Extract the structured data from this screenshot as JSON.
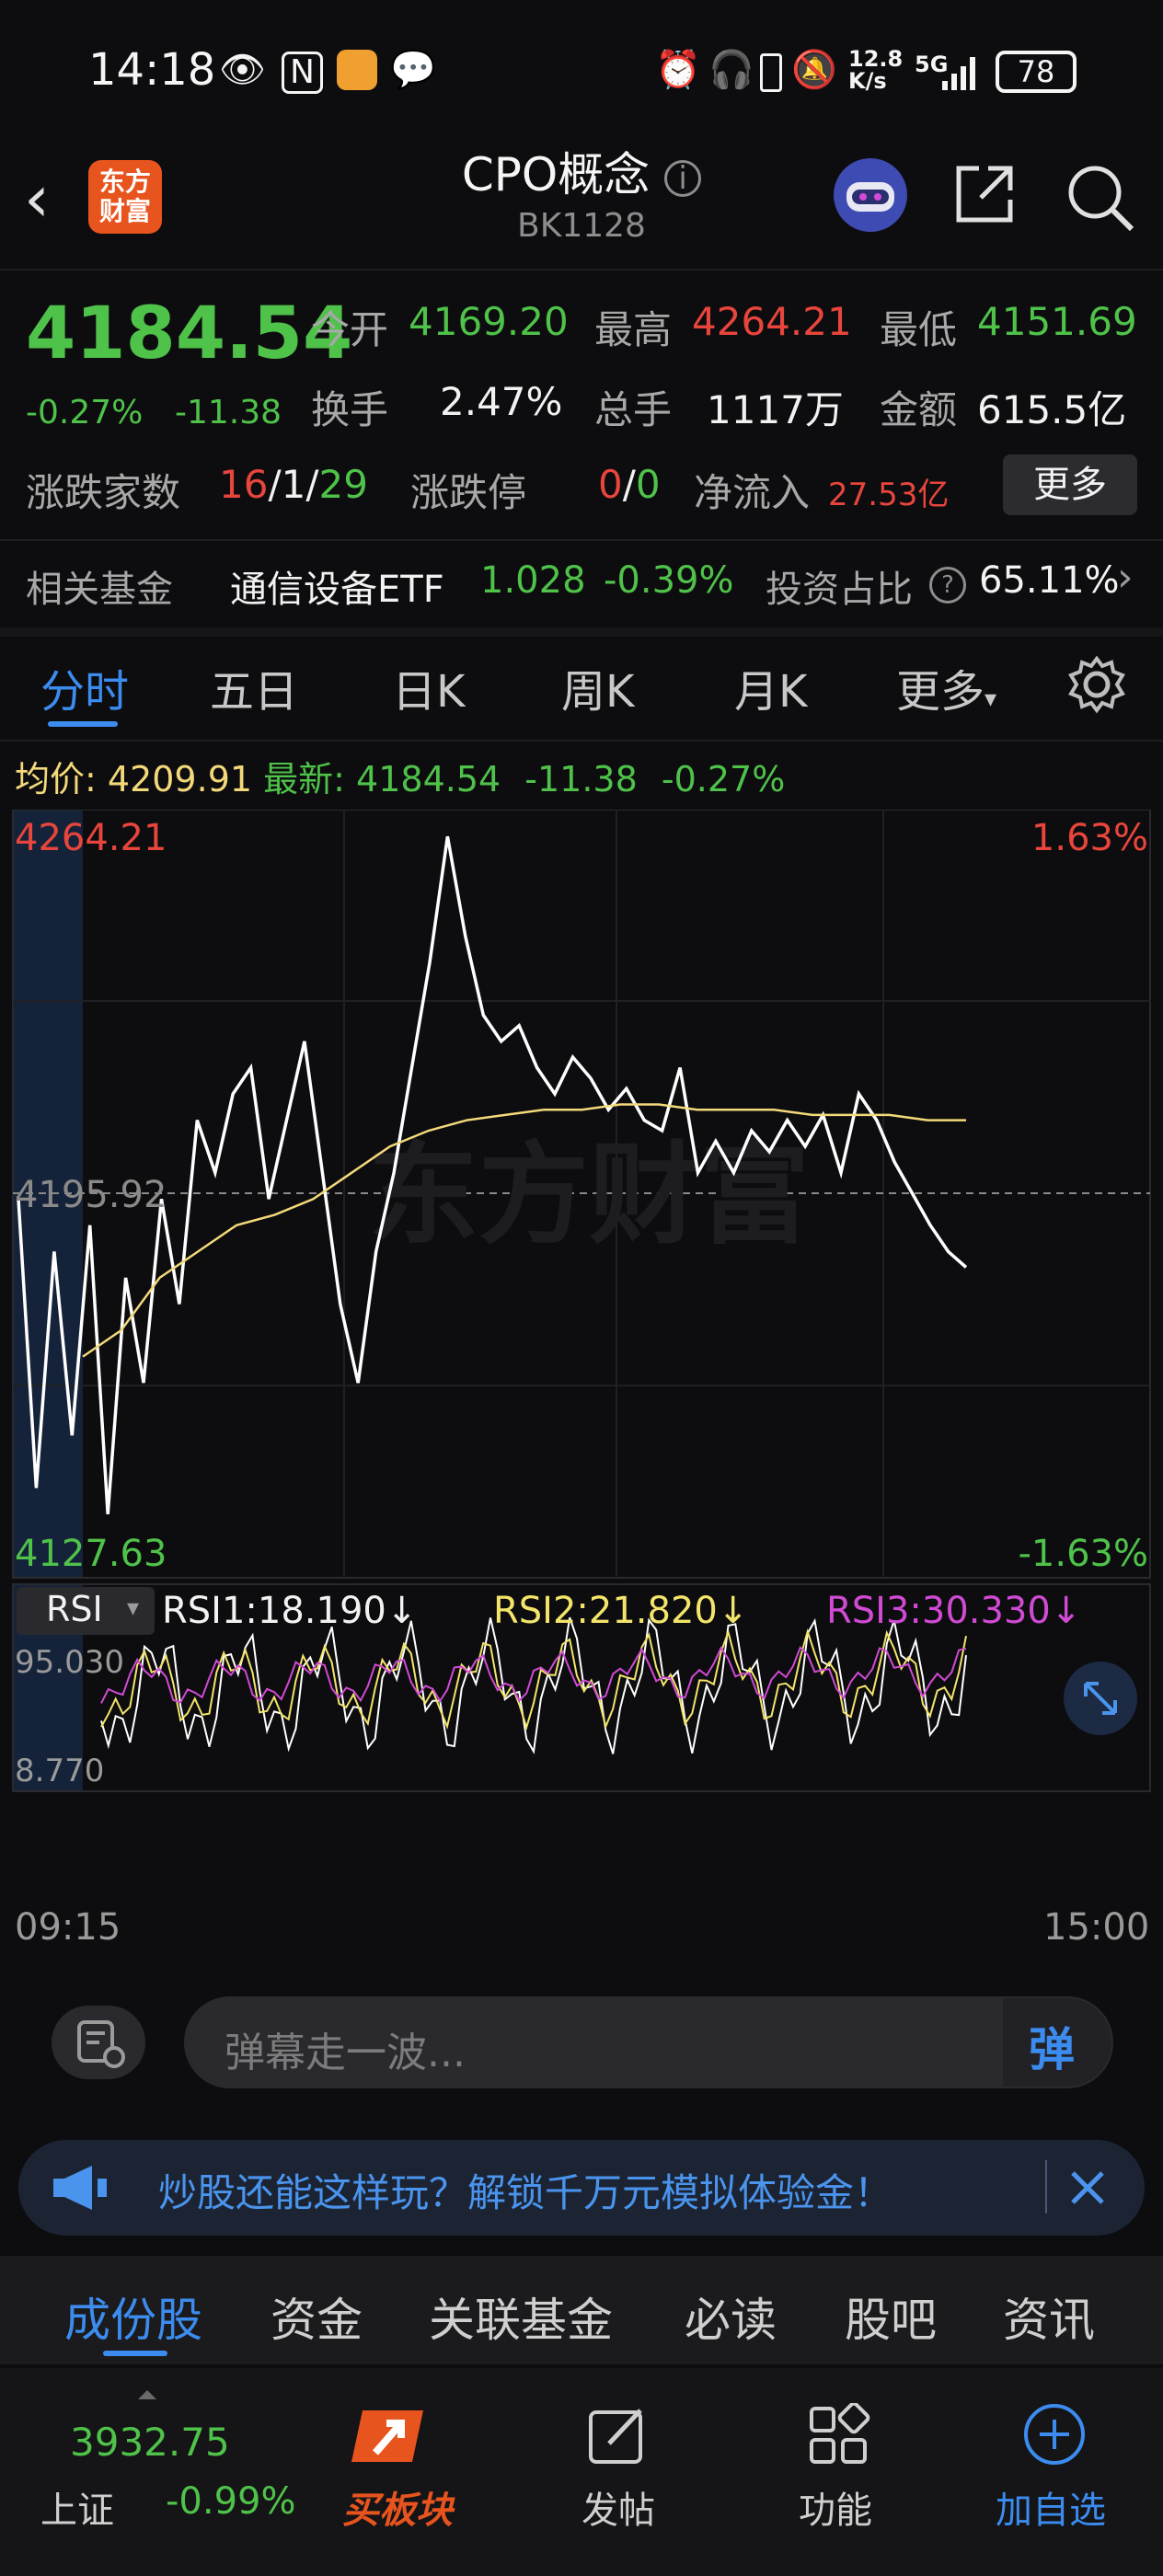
{
  "status": {
    "time": "14:18",
    "speed": "12.8\nK/s",
    "network": "5G",
    "battery": "78"
  },
  "header": {
    "logo_text": "东方\n财富",
    "title": "CPO概念",
    "code": "BK1128"
  },
  "quote": {
    "last": "4184.54",
    "pct": "-0.27%",
    "chg": "-11.38",
    "open_label": "今开",
    "open": "4169.20",
    "high_label": "最高",
    "high": "4264.21",
    "low_label": "最低",
    "low": "4151.69",
    "turnover_label": "换手",
    "turnover": "2.47%",
    "volume_label": "总手",
    "volume": "1117万",
    "amount_label": "金额",
    "amount": "615.5亿",
    "updown_label": "涨跌家数",
    "up": "16",
    "flat": "1",
    "down": "29",
    "limit_label": "涨跌停",
    "limit_up": "0",
    "limit_down": "0",
    "netflow_label": "净流入",
    "netflow": "27.53亿",
    "more": "更多"
  },
  "fund": {
    "label": "相关基金",
    "name": "通信设备ETF",
    "price": "1.028",
    "pct": "-0.39%",
    "ratio_label": "投资占比",
    "ratio": "65.11%"
  },
  "tabs": [
    "分时",
    "五日",
    "日K",
    "周K",
    "月K",
    "更多"
  ],
  "legend": {
    "avg_label": "均价:",
    "avg": "4209.91",
    "latest_label": "最新:",
    "latest": "4184.54",
    "chg": "-11.38",
    "pct": "-0.27%"
  },
  "axis": {
    "top_price": "4264.21",
    "mid_price": "4195.92",
    "bottom_price": "4127.63",
    "top_pct": "1.63%",
    "bottom_pct": "-1.63%",
    "watermark": "东方财富",
    "time_start": "09:15",
    "time_end": "15:00"
  },
  "rsi": {
    "selector": "RSI",
    "rsi1": "RSI1:18.190↓",
    "rsi2": "RSI2:21.820↓",
    "rsi3": "RSI3:30.330↓",
    "top": "95.030",
    "bottom": "8.770"
  },
  "colors": {
    "price_line": "#ffffff",
    "avg_line": "#f3d97a",
    "rsi1": "#ffffff",
    "rsi2": "#f3e46a",
    "rsi3": "#d04ad4",
    "up": "#e8453c",
    "down": "#4fc24a",
    "accent": "#3c8cf0"
  },
  "chart_data": {
    "type": "line",
    "ylim": [
      4127.63,
      4264.21
    ],
    "series": [
      {
        "values": [
          4195,
          4140,
          4185,
          4150,
          4190,
          4135,
          4180,
          4160,
          4195,
          4175,
          4210,
          4200,
          4215,
          4220,
          4195,
          4210,
          4225,
          4200,
          4175,
          4160,
          4185,
          4200,
          4220,
          4240,
          4264,
          4245,
          4230,
          4225,
          4228,
          4220,
          4215,
          4222,
          4218,
          4212,
          4216,
          4210,
          4208,
          4220,
          4200,
          4206,
          4200,
          4208,
          4204,
          4210,
          4205,
          4211,
          4200,
          4215,
          4210,
          4202,
          4196,
          4190,
          4185,
          4182
        ]
      },
      {
        "values": [
          4165,
          4170,
          4180,
          4185,
          4190,
          4192,
          4195,
          4200,
          4205,
          4208,
          4210,
          4211,
          4212,
          4212,
          4213,
          4213,
          4212,
          4212,
          4212,
          4211,
          4211,
          4211,
          4210,
          4210
        ]
      }
    ]
  },
  "danmaku": {
    "placeholder": "弹幕走一波...",
    "send": "弹"
  },
  "banner": {
    "text": "炒股还能这样玩？解锁千万元模拟体验金！"
  },
  "sections": [
    "成份股",
    "资金",
    "关联基金",
    "必读",
    "股吧",
    "资讯"
  ],
  "nav": {
    "index_value": "3932.75",
    "index_name": "上证",
    "index_pct": "-0.99%",
    "buy_block": "买板块",
    "post": "发帖",
    "func": "功能",
    "add": "加自选"
  }
}
